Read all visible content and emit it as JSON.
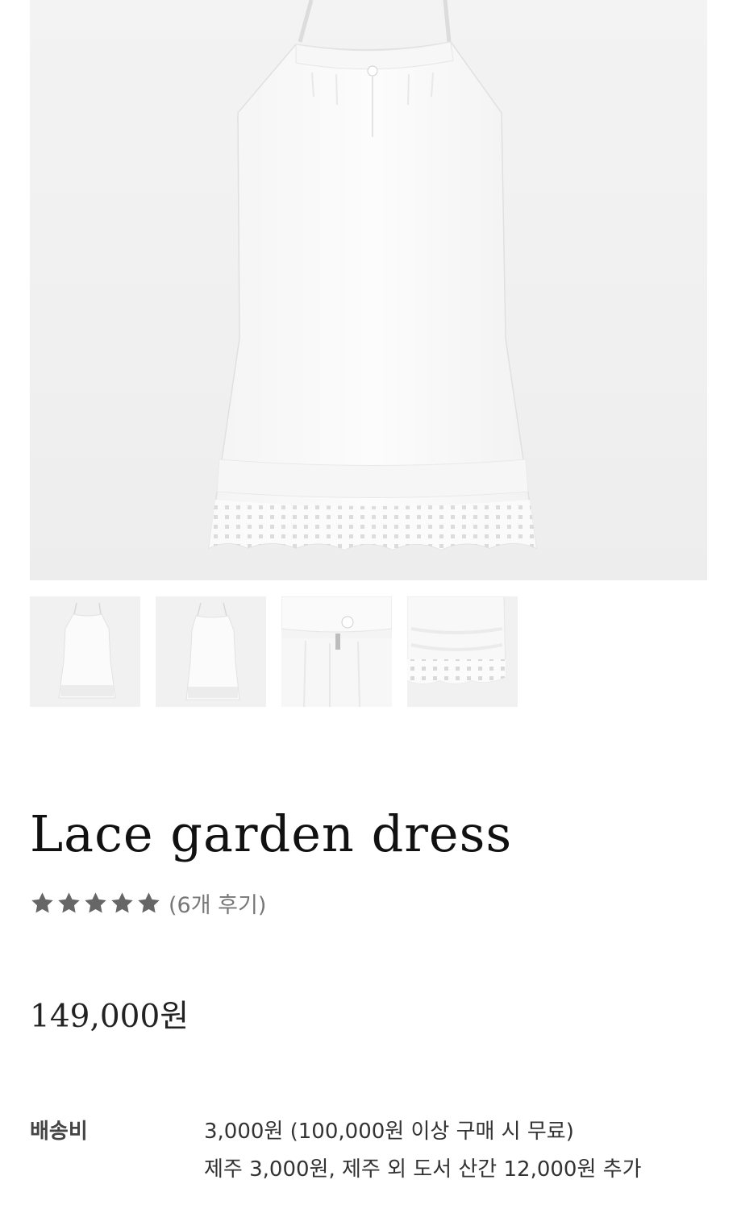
{
  "product": {
    "title": "Lace garden dress",
    "rating": {
      "stars": 5,
      "max": 5,
      "review_text": "(6개 후기)"
    },
    "price": "149,000원"
  },
  "gallery": {
    "thumbnails": [
      {
        "name": "dress-front-full"
      },
      {
        "name": "dress-back-full"
      },
      {
        "name": "dress-button-detail"
      },
      {
        "name": "dress-hem-lace-detail"
      }
    ]
  },
  "shipping": {
    "label": "배송비",
    "line1": "3,000원 (100,000원 이상 구매 시 무료)",
    "line2": "제주 3,000원, 제주 외 도서 산간 12,000원 추가"
  },
  "colors": {
    "star": "#666666",
    "text_muted": "#777777",
    "image_bg": "#f1f1f1"
  }
}
